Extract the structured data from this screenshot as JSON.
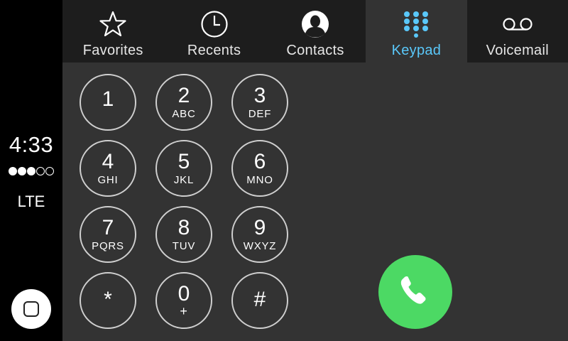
{
  "status": {
    "time": "4:33",
    "signal_bars": 3,
    "signal_total": 5,
    "network": "LTE"
  },
  "tabs": [
    {
      "label": "Favorites",
      "icon": "star-icon",
      "active": false
    },
    {
      "label": "Recents",
      "icon": "clock-icon",
      "active": false
    },
    {
      "label": "Contacts",
      "icon": "contact-icon",
      "active": false
    },
    {
      "label": "Keypad",
      "icon": "keypad-icon",
      "active": true
    },
    {
      "label": "Voicemail",
      "icon": "voicemail-icon",
      "active": false
    }
  ],
  "keypad": {
    "keys": [
      {
        "digit": "1",
        "letters": ""
      },
      {
        "digit": "2",
        "letters": "ABC"
      },
      {
        "digit": "3",
        "letters": "DEF"
      },
      {
        "digit": "4",
        "letters": "GHI"
      },
      {
        "digit": "5",
        "letters": "JKL"
      },
      {
        "digit": "6",
        "letters": "MNO"
      },
      {
        "digit": "7",
        "letters": "PQRS"
      },
      {
        "digit": "8",
        "letters": "TUV"
      },
      {
        "digit": "9",
        "letters": "WXYZ"
      },
      {
        "digit": "*",
        "letters": ""
      },
      {
        "digit": "0",
        "letters": "+"
      },
      {
        "digit": "#",
        "letters": ""
      }
    ]
  },
  "colors": {
    "accent": "#5ac8fa",
    "call_green": "#4cd964",
    "background": "#333333",
    "tabbar": "#1d1d1d"
  }
}
